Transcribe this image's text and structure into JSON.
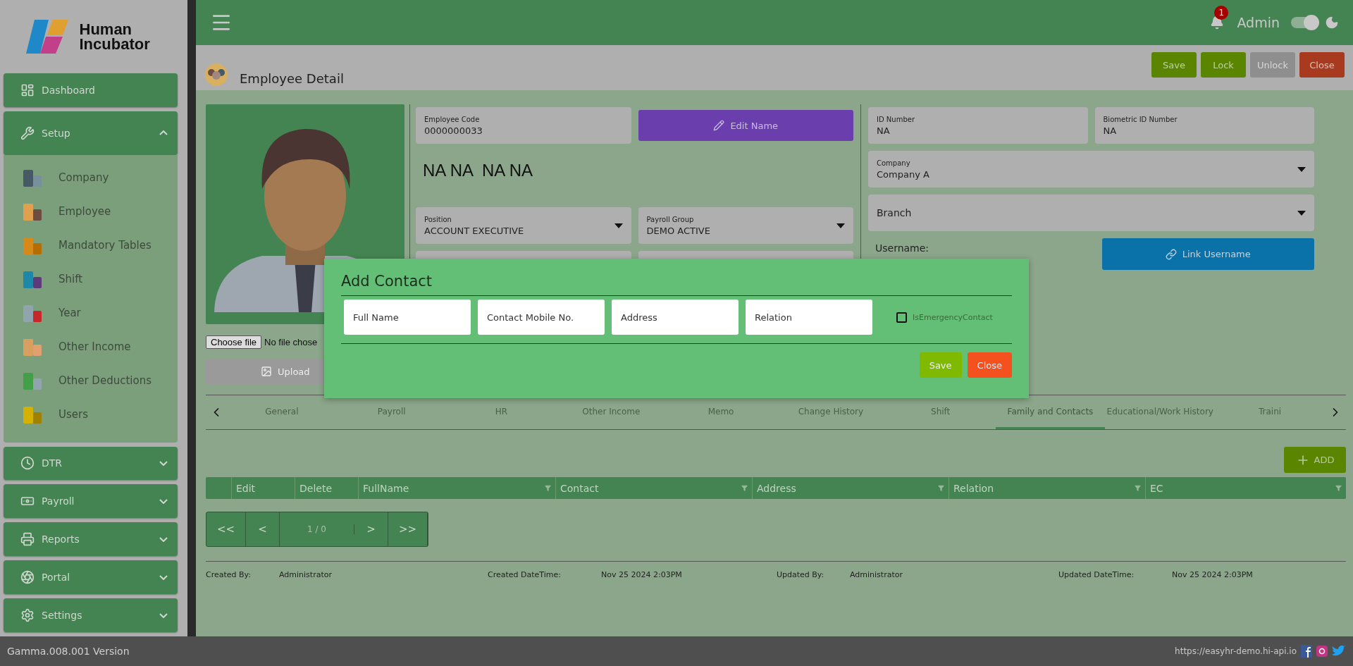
{
  "sidebar": {
    "logo": "Human Incubator",
    "nav": [
      {
        "label": "Dashboard",
        "kind": "link"
      },
      {
        "label": "Setup",
        "kind": "group",
        "expanded": true,
        "children": [
          {
            "label": "Company"
          },
          {
            "label": "Employee"
          },
          {
            "label": "Mandatory Tables"
          },
          {
            "label": "Shift"
          },
          {
            "label": "Year"
          },
          {
            "label": "Other Income"
          },
          {
            "label": "Other Deductions"
          },
          {
            "label": "Users"
          }
        ]
      },
      {
        "label": "DTR",
        "kind": "group",
        "expanded": false
      },
      {
        "label": "Payroll",
        "kind": "group",
        "expanded": false
      },
      {
        "label": "Reports",
        "kind": "group",
        "expanded": false
      },
      {
        "label": "Portal",
        "kind": "group",
        "expanded": false
      },
      {
        "label": "Settings",
        "kind": "group",
        "expanded": false
      }
    ]
  },
  "header": {
    "notification_count": "1",
    "user": "Admin",
    "dark_mode": {
      "on": true
    }
  },
  "page": {
    "title": "Employee Detail",
    "actions": [
      {
        "label": "Save",
        "kind": "primary"
      },
      {
        "label": "Lock",
        "kind": "primary"
      },
      {
        "label": "Unlock",
        "kind": "disabled"
      },
      {
        "label": "Close",
        "kind": "danger"
      }
    ]
  },
  "photo": {
    "choose_file": "Choose file",
    "file_status": "No file chose",
    "upload_button": "Upload"
  },
  "employee": {
    "code": {
      "label": "Employee Code",
      "value": "0000000033"
    },
    "edit_name_button": "Edit Name",
    "full_name": "NA NA  NA NA",
    "fields": [
      {
        "label": "Position",
        "value": "ACCOUNT EXECUTIVE",
        "kind": "select"
      },
      {
        "label": "Payroll Group",
        "value": "DEMO ACTIVE",
        "kind": "select"
      }
    ]
  },
  "identity": {
    "fields": [
      {
        "label": "ID Number",
        "value": "NA",
        "kind": "text"
      },
      {
        "label": "Biometric ID Number",
        "value": "NA",
        "kind": "text"
      },
      {
        "label": "Company",
        "value": "Company A",
        "kind": "select"
      },
      {
        "label": "Branch",
        "kind": "select"
      }
    ],
    "username_label": "Username:",
    "link_username_button": "Link Username"
  },
  "tabs": [
    {
      "label": "General",
      "selected": false
    },
    {
      "label": "Payroll",
      "selected": false
    },
    {
      "label": "HR",
      "selected": false
    },
    {
      "label": "Other Income",
      "selected": false
    },
    {
      "label": "Memo",
      "selected": false
    },
    {
      "label": "Change History",
      "selected": false
    },
    {
      "label": "Shift",
      "selected": false
    },
    {
      "label": "Family and Contacts",
      "selected": true
    },
    {
      "label": "Educational/Work History",
      "selected": false
    },
    {
      "label": "Traini",
      "selected": false
    }
  ],
  "add_button": "ADD",
  "table": {
    "columns": [
      {
        "label": "Edit",
        "kind": "action"
      },
      {
        "label": "Delete",
        "kind": "action"
      },
      {
        "label": "FullName",
        "kind": "filter"
      },
      {
        "label": "Contact",
        "kind": "filter"
      },
      {
        "label": "Address",
        "kind": "filter"
      },
      {
        "label": "Relation",
        "kind": "filter"
      },
      {
        "label": "EC",
        "kind": "filter"
      }
    ]
  },
  "pager": {
    "first": "<<",
    "prev": "<",
    "page": "1 / 0",
    "next": ">",
    "last": ">>"
  },
  "audit": [
    {
      "label": "Created By:",
      "value": "Administrator"
    },
    {
      "label": "Created DateTime:",
      "value": "Nov 25 2024 2:03PM"
    },
    {
      "label": "Updated By:",
      "value": "Administrator"
    },
    {
      "label": "Updated DateTime:",
      "value": "Nov 25 2024 2:03PM"
    }
  ],
  "footer": {
    "version": "Gamma.008.001 Version",
    "url": "https://easyhr-demo.hi-api.io"
  },
  "modal": {
    "title": "Add Contact",
    "fields": [
      {
        "placeholder": "Full Name"
      },
      {
        "placeholder": "Contact Mobile No."
      },
      {
        "placeholder": "Address"
      },
      {
        "placeholder": "Relation"
      }
    ],
    "emergency": {
      "label": "IsEmergencyContact",
      "checked": false
    },
    "buttons": [
      {
        "label": "Save",
        "kind": "save"
      },
      {
        "label": "Close",
        "kind": "close"
      }
    ]
  }
}
